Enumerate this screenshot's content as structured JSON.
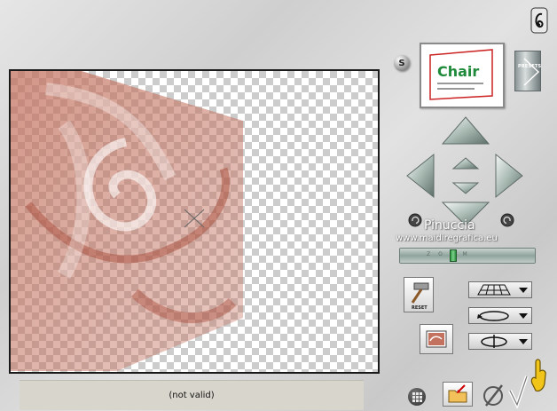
{
  "status": {
    "text": "(not valid)"
  },
  "branding": {
    "name": "Pinuccia",
    "url": "www.maidiregrafica.eu"
  },
  "presets": {
    "label": "PRESETS",
    "thumbnail_text": "Chair"
  },
  "s_button": {
    "label": "S"
  },
  "zoom": {
    "label": "ZOOM"
  },
  "reset": {
    "label": "RESET"
  },
  "colors": {
    "tile_color": "#c3725f",
    "arrow_color": "#a9bab3",
    "check_mark": "#f0c419"
  },
  "icons": [
    "logo-icon",
    "arrow-up-icon",
    "arrow-down-icon",
    "arrow-left-icon",
    "arrow-right-icon",
    "move-up-icon",
    "move-down-icon",
    "rotate-left-icon",
    "rotate-right-icon",
    "hammer-icon",
    "perspective-grid-icon",
    "rotate-horizontal-icon",
    "rotate-vertical-icon",
    "grid-view-icon",
    "folder-icon",
    "cancel-icon",
    "ok-check-icon",
    "hand-icon"
  ]
}
